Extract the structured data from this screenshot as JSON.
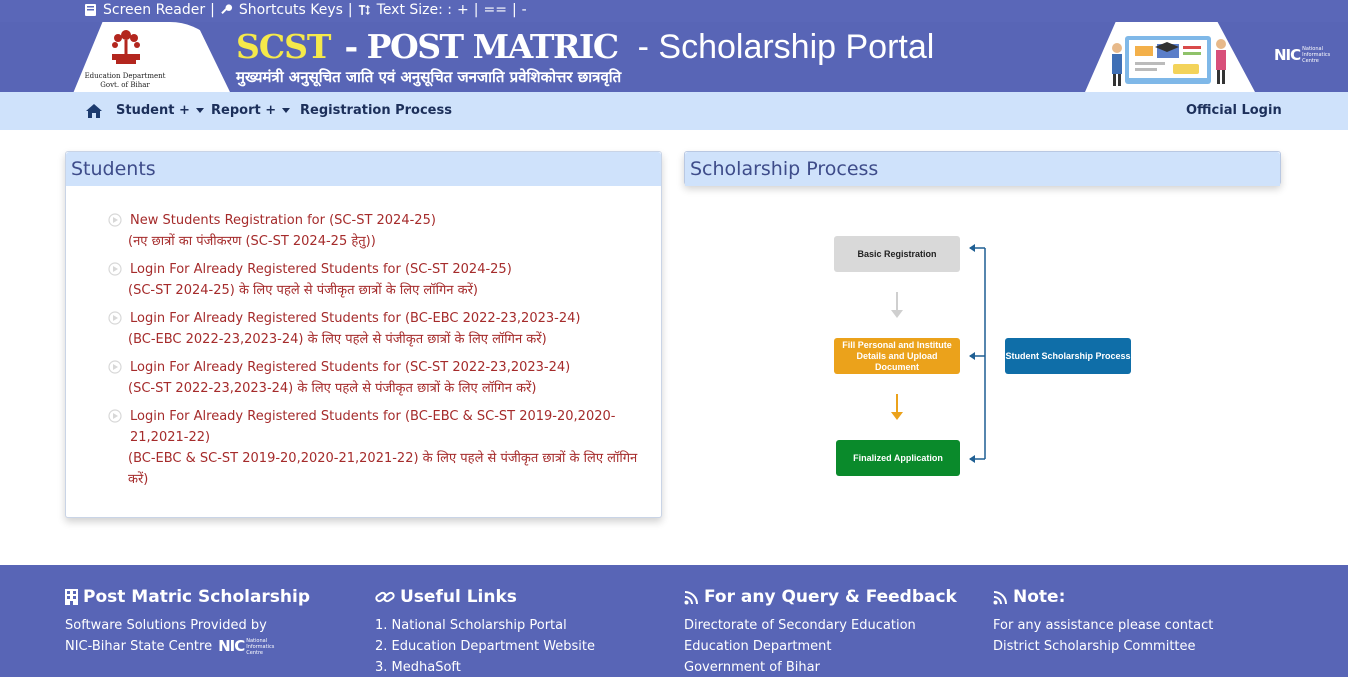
{
  "topbar": {
    "screen_reader": "Screen Reader",
    "shortcuts": "Shortcuts Keys",
    "text_size_label": "Text Size: :",
    "size_plus": "+",
    "size_normal": "==",
    "size_minus": "-",
    "sep": "|"
  },
  "banner": {
    "dept_line1": "Education Department",
    "dept_line2": "Govt. of Bihar",
    "title_scst": "SCST",
    "title_pm": "- POST MATRIC",
    "title_sp": "- Scholarship Portal",
    "subtitle": "मुख्यमंत्री अनुसूचित जाति एवं अनुसूचित जनजाति  प्रवेशिकोत्तर छात्रवृति",
    "nic_short": "NIC",
    "nic_full": "National Informatics Centre"
  },
  "nav": {
    "student": "Student +",
    "report": "Report +",
    "registration": "Registration Process",
    "official_login": "Official Login"
  },
  "students": {
    "title": "Students",
    "items": [
      {
        "en": "New Students Registration for (SC-ST 2024-25)",
        "hi": "(नए छात्रों का पंजीकरण (SC-ST 2024-25 हेतु))"
      },
      {
        "en": "Login For Already Registered Students for (SC-ST 2024-25)",
        "hi": "(SC-ST 2024-25) के लिए पहले से पंजीकृत छात्रों के लिए लॉगिन करें)"
      },
      {
        "en": "Login For Already Registered Students for (BC-EBC 2022-23,2023-24)",
        "hi": "(BC-EBC 2022-23,2023-24) के लिए पहले से पंजीकृत छात्रों के लिए लॉगिन करें)"
      },
      {
        "en": "Login For Already Registered Students for (SC-ST 2022-23,2023-24)",
        "hi": "(SC-ST 2022-23,2023-24) के लिए पहले से पंजीकृत छात्रों के लिए लॉगिन करें)"
      },
      {
        "en": "Login For Already Registered Students for (BC-EBC & SC-ST 2019-20,2020-21,2021-22)",
        "hi": "(BC-EBC & SC-ST 2019-20,2020-21,2021-22) के लिए पहले से पंजीकृत छात्रों के लिए लॉगिन करें)"
      }
    ]
  },
  "process": {
    "title": "Scholarship Process",
    "box_basic": "Basic Registration",
    "box_fill": "Fill Personal and Institute Details and Upload Document",
    "box_final": "Finalized Application",
    "box_student": "Student Scholarship Process"
  },
  "footer": {
    "col1_title": "Post Matric Scholarship",
    "col1_line1": "Software Solutions Provided by",
    "col1_line2": "NIC-Bihar State Centre",
    "col2_title": "Useful Links",
    "col2_links": [
      "1. National Scholarship Portal",
      "2. Education Department Website",
      "3. MedhaSoft"
    ],
    "col3_title": "For any Query & Feedback",
    "col3_lines": [
      "Directorate of Secondary Education",
      "Education Department",
      "Government of Bihar"
    ],
    "col4_title": "Note:",
    "col4_lines": [
      "For any assistance please contact",
      "District Scholarship Committee"
    ]
  },
  "colors": {
    "brand_blue": "#5865b6",
    "nav_bg": "#cfe2fb",
    "link_red": "#a52b2b",
    "title_yellow": "#f5e94a"
  }
}
